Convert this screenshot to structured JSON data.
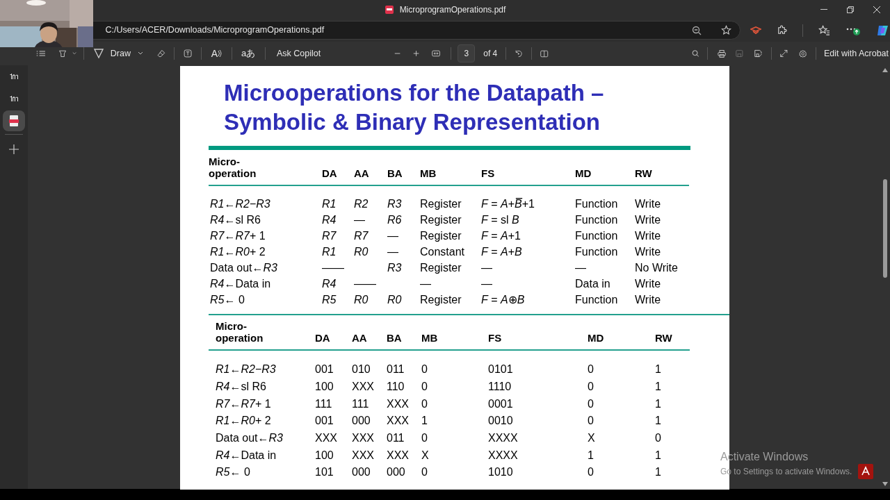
{
  "window": {
    "title": "MicroprogramOperations.pdf"
  },
  "address_bar": {
    "url": "C:/Users/ACER/Downloads/MicroprogramOperations.pdf"
  },
  "vertical_tabs": [
    {
      "kind": "site",
      "selected": false
    },
    {
      "kind": "site",
      "selected": false
    },
    {
      "kind": "pdf",
      "selected": true
    }
  ],
  "pdf_toolbar": {
    "draw_label": "Draw",
    "read_aloud_glyph": "A",
    "translate_glyph": "aあ",
    "ask_copilot": "Ask Copilot",
    "page_number": "3",
    "page_count": "of 4",
    "save_disabled": true,
    "edit_button": "Edit with Acrobat"
  },
  "slide": {
    "title": "Microoperations for the Datapath –\nSymbolic & Binary Representation",
    "tables": [
      {
        "kind": "symbolic",
        "columns": [
          "Micro-\noperation",
          "DA",
          "AA",
          "BA",
          "MB",
          "FS",
          "MD",
          "RW"
        ],
        "rows": [
          {
            "op": "*R1*←*R2*−*R3*",
            "da": "*R1*",
            "aa": "*R2*",
            "ba": "*R3*",
            "mb": "Register",
            "fs": "*F* = *A*+*B̅*+1",
            "md": "Function",
            "rw": "Write"
          },
          {
            "op": "*R4*←sl R6",
            "da": "*R4*",
            "aa": "—",
            "ba": "*R6*",
            "mb": "Register",
            "fs": "*F* = sl *B*",
            "md": "Function",
            "rw": "Write"
          },
          {
            "op": "*R7*←*R7*+ 1",
            "da": "*R7*",
            "aa": "*R7*",
            "ba": "—",
            "mb": "Register",
            "fs": "*F* = *A*+1",
            "md": "Function",
            "rw": "Write"
          },
          {
            "op": "*R1*←*R0*+ 2",
            "da": "*R1*",
            "aa": "*R0*",
            "ba": "—",
            "mb": "Constant",
            "fs": "*F* = *A*+*B*",
            "md": "Function",
            "rw": "Write"
          },
          {
            "op": "Data out←*R3*",
            "da": "——",
            "ba": "*R3*",
            "mb": "Register",
            "fs": "—",
            "md": "—",
            "rw": "No Write"
          },
          {
            "op": "*R4*←Data in",
            "da": "*R4*",
            "aa": "——",
            "mb": "—",
            "fs": "—",
            "md": "Data in",
            "rw": "Write"
          },
          {
            "op": "*R5*← 0",
            "da": "*R5*",
            "aa": "*R0*",
            "ba": "*R0*",
            "mb": "Register",
            "fs": "*F* = *A*⊕*B*",
            "md": "Function",
            "rw": "Write"
          }
        ]
      },
      {
        "kind": "binary",
        "columns": [
          "Micro-\noperation",
          "DA",
          "AA",
          "BA",
          "MB",
          "FS",
          "MD",
          "RW"
        ],
        "rows": [
          {
            "op": "*R1*←*R2*−*R3*",
            "da": "001",
            "aa": "010",
            "ba": "011",
            "mb": "0",
            "fs": "0101",
            "md": "0",
            "rw": "1"
          },
          {
            "op": "*R4*←sl R6",
            "da": "100",
            "aa": "XXX",
            "ba": "110",
            "mb": "0",
            "fs": "1110",
            "md": "0",
            "rw": "1"
          },
          {
            "op": "*R7*←*R7*+ 1",
            "da": "111",
            "aa": "111",
            "ba": "XXX",
            "mb": "0",
            "fs": "0001",
            "md": "0",
            "rw": "1"
          },
          {
            "op": "*R1*←*R0*+ 2",
            "da": "001",
            "aa": "000",
            "ba": "XXX",
            "mb": "1",
            "fs": "0010",
            "md": "0",
            "rw": "1"
          },
          {
            "op": "Data out←*R3*",
            "da": "XXX",
            "aa": "XXX",
            "ba": "011",
            "mb": "0",
            "fs": "XXXX",
            "md": "X",
            "rw": "0"
          },
          {
            "op": "*R4*←Data in",
            "da": "100",
            "aa": "XXX",
            "ba": "XXX",
            "mb": "X",
            "fs": "XXXX",
            "md": "1",
            "rw": "1"
          },
          {
            "op": "*R5*← 0",
            "da": "101",
            "aa": "000",
            "ba": "000",
            "mb": "0",
            "fs": "1010",
            "md": "0",
            "rw": "1"
          }
        ]
      }
    ]
  },
  "activation_notice": {
    "title": "Activate Windows",
    "subtitle": "Go to Settings to activate Windows."
  }
}
